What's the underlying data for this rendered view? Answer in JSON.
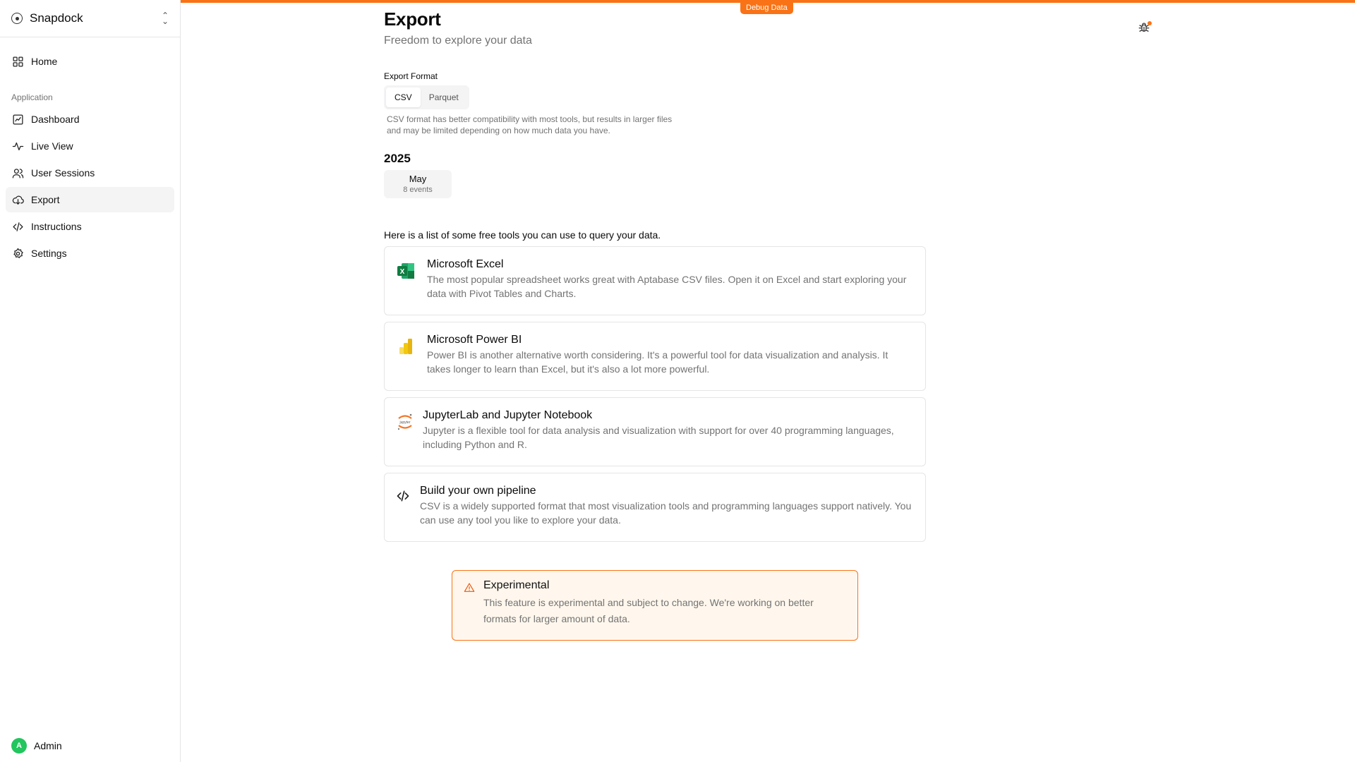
{
  "app": {
    "workspace_name": "Snapdock",
    "debug_badge": "Debug Data"
  },
  "sidebar": {
    "home_label": "Home",
    "section_label": "Application",
    "items": [
      {
        "label": "Dashboard",
        "icon": "chart-icon"
      },
      {
        "label": "Live View",
        "icon": "activity-icon"
      },
      {
        "label": "User Sessions",
        "icon": "users-icon"
      },
      {
        "label": "Export",
        "icon": "cloud-download-icon"
      },
      {
        "label": "Instructions",
        "icon": "code-icon"
      },
      {
        "label": "Settings",
        "icon": "gear-icon"
      }
    ],
    "active_item": "Export",
    "user": {
      "initial": "A",
      "name": "Admin"
    }
  },
  "page": {
    "title": "Export",
    "subtitle": "Freedom to explore your data"
  },
  "export_format": {
    "label": "Export Format",
    "tabs": [
      "CSV",
      "Parquet"
    ],
    "selected": "CSV",
    "help": "CSV format has better compatibility with most tools, but results in larger files and may be limited depending on how much data you have."
  },
  "exports": {
    "year": "2025",
    "month": {
      "name": "May",
      "count": "8 events"
    }
  },
  "tools": {
    "intro": "Here is a list of some free tools you can use to query your data.",
    "items": [
      {
        "name": "Microsoft Excel",
        "description": "The most popular spreadsheet works great with Aptabase CSV files. Open it on Excel and start exploring your data with Pivot Tables and Charts.",
        "icon": "excel-icon"
      },
      {
        "name": "Microsoft Power BI",
        "description": "Power BI is another alternative worth considering. It's a powerful tool for data visualization and analysis. It takes longer to learn than Excel, but it's also a lot more powerful.",
        "icon": "power-bi-icon"
      },
      {
        "name": "JupyterLab and Jupyter Notebook",
        "description": "Jupyter is a flexible tool for data analysis and visualization with support for over 40 programming languages, including Python and R.",
        "icon": "jupyter-icon",
        "icon_text": "jupyter"
      },
      {
        "name": "Build your own pipeline",
        "description": "CSV is a widely supported format that most visualization tools and programming languages support natively. You can use any tool you like to explore your data.",
        "icon": "code-icon"
      }
    ]
  },
  "alert": {
    "title": "Experimental",
    "text": "This feature is experimental and subject to change. We're working on better formats for larger amount of data.",
    "icon": "warning-icon"
  },
  "colors": {
    "accent": "#f97316",
    "alert_bg": "#fff7ed",
    "muted_text": "#737373",
    "excel_green": "#107c41",
    "powerbi_yellow": "#f2c811"
  }
}
